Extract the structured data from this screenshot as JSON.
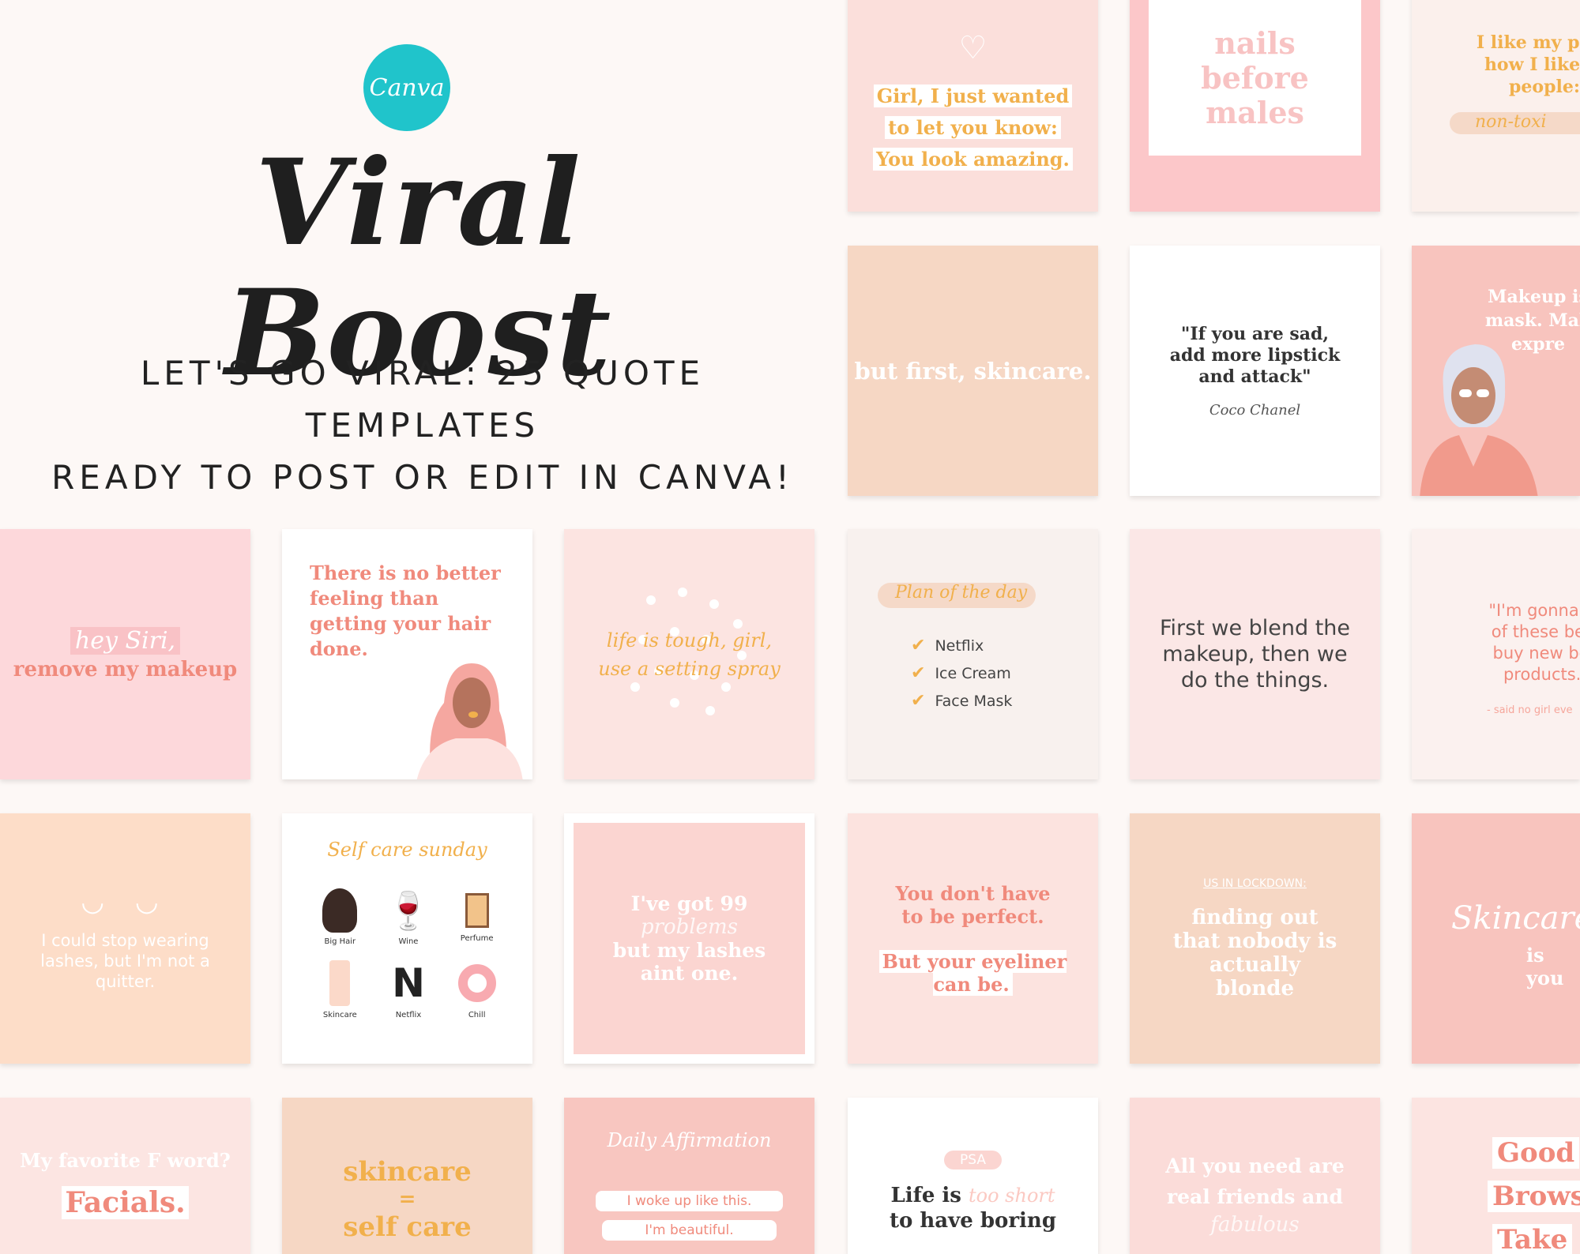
{
  "hero": {
    "logo_text": "Canva",
    "title": "Viral Boost",
    "subtitle_line1": "LET'S GO VIRAL:  25 QUOTE TEMPLATES",
    "subtitle_line2": "READY TO POST OR EDIT IN CANVA!"
  },
  "tiles": {
    "girl_wanted": {
      "line1": "Girl, I just wanted",
      "line2": "to let you know:",
      "line3": "You look amazing."
    },
    "nails": {
      "text": "nails before males"
    },
    "products": {
      "line1": "I like my prod",
      "line2": "how I like m",
      "line3": "people:",
      "script": "non-toxi"
    },
    "skincare_first": {
      "text": "but first, skincare."
    },
    "sad_lipstick": {
      "quote": "\"If you are sad, add more lipstick and attack\"",
      "author": "Coco Chanel"
    },
    "makeup_mask": {
      "line1": "Makeup is",
      "line2": "mask. Mak",
      "line3": "expre"
    },
    "hey_siri": {
      "script": "hey Siri,",
      "text": "remove my makeup"
    },
    "hair_done": {
      "text": "There is no better feeling than getting your hair done."
    },
    "life_tough": {
      "line1": "life is tough, girl,",
      "line2": "use a setting spray"
    },
    "plan": {
      "title": "Plan of the day",
      "items": [
        "Netflix",
        "Ice Cream",
        "Face Mask"
      ]
    },
    "blend": {
      "text": "First we blend the makeup, then we do the things."
    },
    "gonna_use": {
      "line1": "\"I'm gonna us",
      "line2": "of these befo",
      "line3": "buy new bea",
      "line4": "products.\"",
      "author": "- said no girl eve"
    },
    "lashes": {
      "text": "I could stop wearing lashes, but I'm not a quitter."
    },
    "self_care": {
      "title": "Self care sunday",
      "items": [
        "Big Hair",
        "Wine",
        "Perfume",
        "Skincare",
        "Netflix",
        "Chill"
      ]
    },
    "problems": {
      "line1": "I've got 99",
      "script": "problems",
      "line2": "but my lashes",
      "line3": "aint one."
    },
    "perfect": {
      "line1": "You don't have to be perfect.",
      "line2": "But your eyeliner can be."
    },
    "lockdown": {
      "label": "US IN LOCKDOWN:",
      "text": "finding out that nobody is actually blonde"
    },
    "skincare_is": {
      "script": "Skincare",
      "text": "is you"
    },
    "f_word": {
      "line1": "My favorite F word?",
      "line2": "Facials."
    },
    "skincare_self": {
      "line1": "skincare",
      "line2": "=",
      "line3": "self care"
    },
    "affirmation": {
      "title": "Daily Affirmation",
      "items": [
        "I woke up like this.",
        "I'm beautiful."
      ]
    },
    "psa": {
      "label": "PSA",
      "line1": "Life is",
      "script": "too short",
      "line2": "to have boring"
    },
    "friends": {
      "line1": "All you need are",
      "line2": "real friends and",
      "script": "fabulous"
    },
    "good_brows": {
      "items": [
        "Good",
        "Brows",
        "Take"
      ]
    }
  },
  "colors": {
    "teal": "#20c4cb",
    "coral": "#f08a7c",
    "gold": "#f1b04c",
    "pink": "#fbdcd9",
    "peach": "#f7dcc9"
  }
}
